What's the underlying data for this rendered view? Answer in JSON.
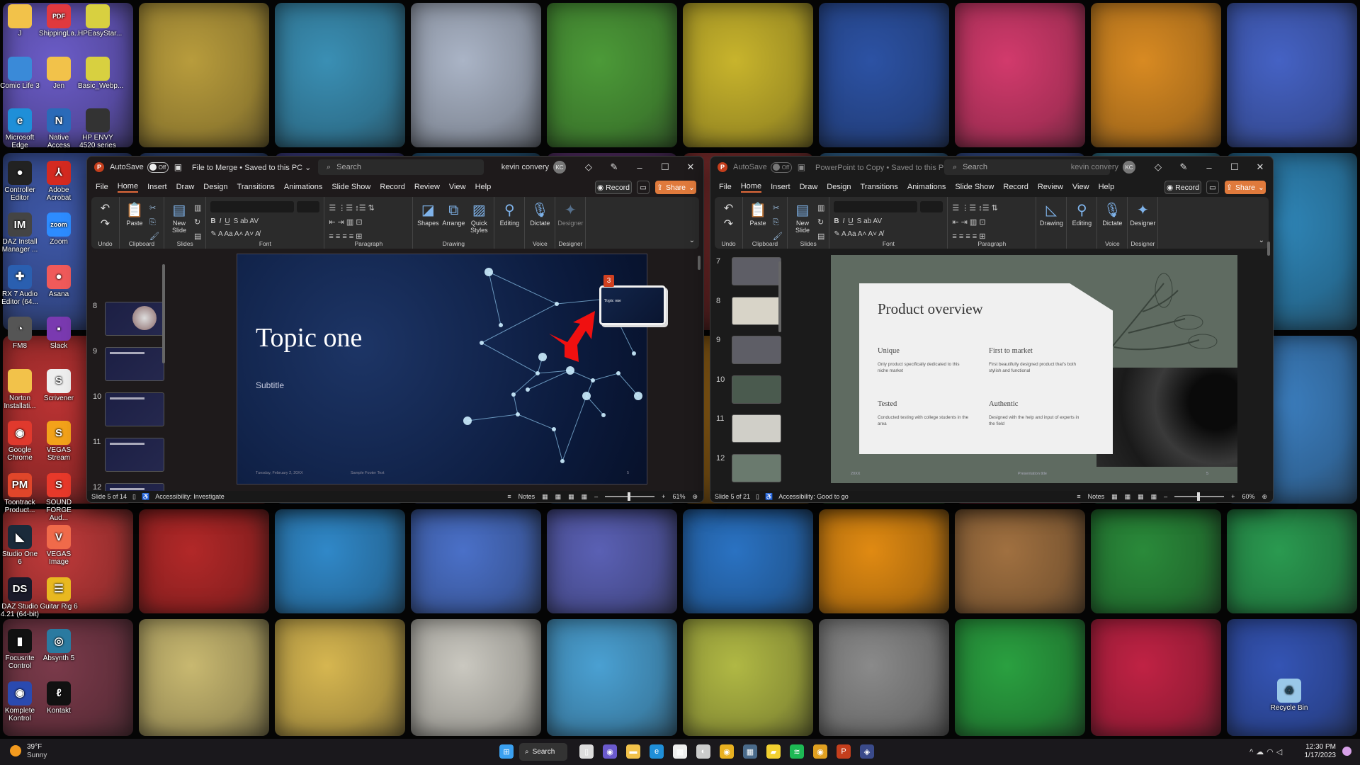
{
  "desktop": {
    "icons": [
      [
        "J",
        "ShippingLa...",
        "HPEasyStar..."
      ],
      [
        "Comic Life 3",
        "Jen",
        "Basic_Webp..."
      ],
      [
        "Microsoft Edge",
        "Native Access",
        "HP ENVY 4520 series"
      ],
      [
        "Controller Editor",
        "Adobe Acrobat"
      ],
      [
        "DAZ Install Manager ...",
        "Zoom"
      ],
      [
        "RX 7 Audio Editor (64...",
        "Asana"
      ],
      [
        "FM8",
        "Slack"
      ],
      [
        "Norton Installati...",
        "Scrivener"
      ],
      [
        "Google Chrome",
        "VEGAS Stream"
      ],
      [
        "Toontrack Product...",
        "SOUND FORGE Aud..."
      ],
      [
        "Studio One 6",
        "VEGAS Image"
      ],
      [
        "DAZ Studio 4.21 (64-bit)",
        "Guitar Rig 6"
      ],
      [
        "Focusrite Control",
        "Absynth 5"
      ],
      [
        "Komplete Kontrol",
        "Kontakt"
      ]
    ],
    "recycle_bin": "Recycle Bin"
  },
  "windows": [
    {
      "active": true,
      "autosave_label": "AutoSave",
      "autosave_state": "Off",
      "title": "File to Merge • Saved to this PC ⌄",
      "search_placeholder": "Search",
      "user_name": "kevin convery",
      "user_initials": "KC",
      "tabs": [
        "File",
        "Home",
        "Insert",
        "Draw",
        "Design",
        "Transitions",
        "Animations",
        "Slide Show",
        "Record",
        "Review",
        "View",
        "Help"
      ],
      "active_tab": "Home",
      "record_label": "Record",
      "share_label": "Share",
      "ribbon": [
        {
          "label": "Undo",
          "buttons": []
        },
        {
          "label": "Clipboard",
          "buttons": [
            "Paste"
          ]
        },
        {
          "label": "Slides",
          "buttons": [
            "New Slide"
          ]
        },
        {
          "label": "Font",
          "font": true
        },
        {
          "label": "Paragraph",
          "para": true
        },
        {
          "label": "Drawing",
          "buttons": [
            "Shapes",
            "Arrange",
            "Quick Styles"
          ]
        },
        {
          "label": "",
          "buttons": [
            "Editing"
          ]
        },
        {
          "label": "Voice",
          "buttons": [
            "Dictate"
          ]
        },
        {
          "label": "Designer",
          "buttons": [
            "Designer"
          ]
        }
      ],
      "thumbnail_numbers": [
        "8",
        "9",
        "10",
        "11",
        "12"
      ],
      "slide": {
        "title": "Topic one",
        "subtitle": "Subtitle",
        "footer_date": "Tuesday, February 2, 20XX",
        "footer_text": "Sample Footer Text",
        "page": "5",
        "drag_count": "3",
        "drag_preview_title": "Topic one"
      },
      "status": {
        "slide_counter": "Slide 5 of 14",
        "accessibility": "Accessibility: Investigate",
        "notes": "Notes",
        "zoom": "61%"
      }
    },
    {
      "active": false,
      "autosave_label": "AutoSave",
      "autosave_state": "Off",
      "title": "PowerPoint to Copy • Saved to this PC ⌄",
      "search_placeholder": "Search",
      "user_name": "kevin convery",
      "user_initials": "KC",
      "tabs": [
        "File",
        "Home",
        "Insert",
        "Draw",
        "Design",
        "Transitions",
        "Animations",
        "Slide Show",
        "Record",
        "Review",
        "View",
        "Help"
      ],
      "active_tab": "Home",
      "record_label": "Record",
      "share_label": "Share",
      "ribbon": [
        {
          "label": "Undo",
          "buttons": []
        },
        {
          "label": "Clipboard",
          "buttons": [
            "Paste"
          ]
        },
        {
          "label": "Slides",
          "buttons": [
            "New Slide"
          ]
        },
        {
          "label": "Font",
          "font": true
        },
        {
          "label": "Paragraph",
          "para": true
        },
        {
          "label": "",
          "buttons": [
            "Drawing"
          ]
        },
        {
          "label": "",
          "buttons": [
            "Editing"
          ]
        },
        {
          "label": "Voice",
          "buttons": [
            "Dictate"
          ]
        },
        {
          "label": "Designer",
          "buttons": [
            "Designer"
          ]
        }
      ],
      "thumbnail_numbers": [
        "7",
        "8",
        "9",
        "10",
        "11",
        "12"
      ],
      "slide": {
        "title": "Product overview",
        "items": [
          {
            "heading": "Unique",
            "text": "Only product specifically dedicated to this niche market"
          },
          {
            "heading": "First to market",
            "text": "First beautifully designed product that's both stylish and functional"
          },
          {
            "heading": "Tested",
            "text": "Conducted testing with college students in the area"
          },
          {
            "heading": "Authentic",
            "text": "Designed with the help and input of experts in the field"
          }
        ],
        "footer_date": "20XX",
        "footer_text": "Presentation title",
        "page": "5"
      },
      "status": {
        "slide_counter": "Slide 5 of 21",
        "accessibility": "Accessibility: Good to go",
        "notes": "Notes",
        "zoom": "60%"
      }
    }
  ],
  "taskbar": {
    "weather_temp": "39°F",
    "weather_desc": "Sunny",
    "search_label": "Search",
    "time": "12:30 PM",
    "date": "1/17/2023",
    "apps": [
      "start-icon",
      "task-view-icon",
      "teams-icon",
      "file-explorer-icon",
      "edge-icon",
      "store-icon",
      "alienware-icon",
      "chrome-icon",
      "calculator-icon",
      "sticky-notes-icon",
      "spotify-icon",
      "chrome-profile-icon",
      "powerpoint-icon",
      "app-icon"
    ]
  },
  "colors": {
    "accent": "#e07a3c",
    "ppt": "#c43e1c"
  }
}
